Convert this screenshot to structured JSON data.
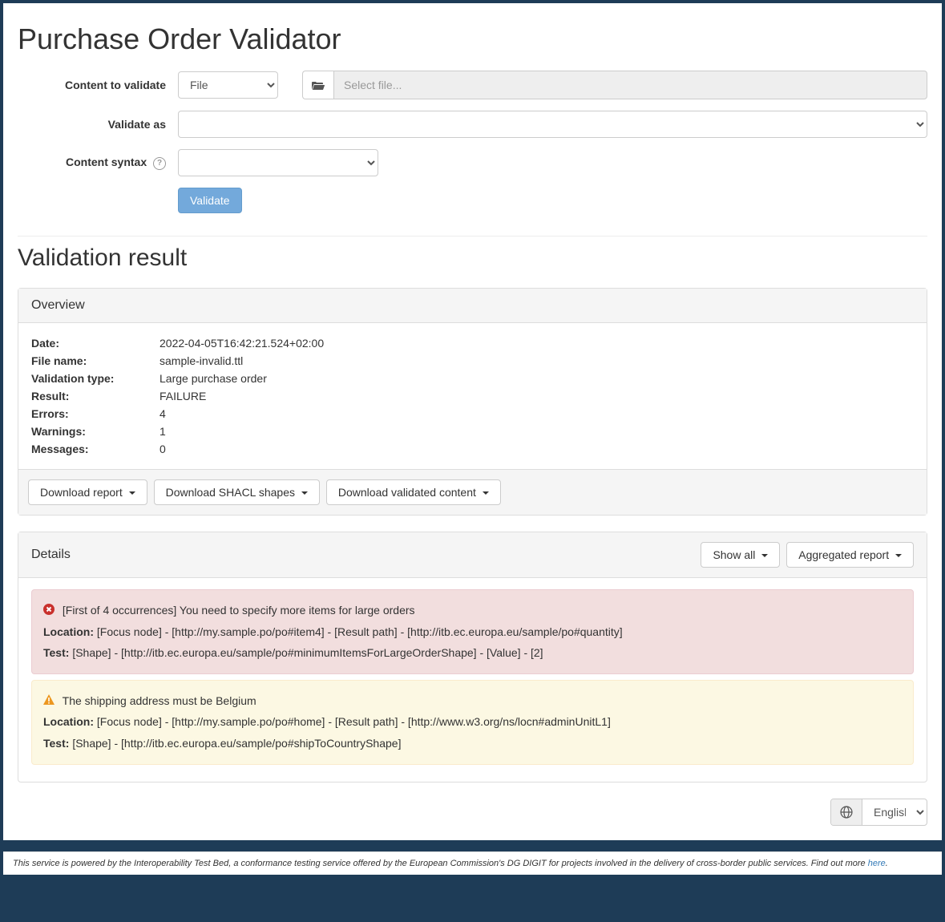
{
  "title": "Purchase Order Validator",
  "form": {
    "content_label": "Content to validate",
    "content_mode": "File",
    "file_placeholder": "Select file...",
    "validate_as_label": "Validate as",
    "validate_as_value": "",
    "syntax_label": "Content syntax",
    "syntax_value": "",
    "validate_button": "Validate"
  },
  "result_title": "Validation result",
  "overview": {
    "heading": "Overview",
    "date_label": "Date:",
    "date_value": "2022-04-05T16:42:21.524+02:00",
    "file_label": "File name:",
    "file_value": "sample-invalid.ttl",
    "type_label": "Validation type:",
    "type_value": "Large purchase order",
    "result_label": "Result:",
    "result_value": "FAILURE",
    "errors_label": "Errors:",
    "errors_value": "4",
    "warnings_label": "Warnings:",
    "warnings_value": "1",
    "messages_label": "Messages:",
    "messages_value": "0",
    "dl_report": "Download report",
    "dl_shapes": "Download SHACL shapes",
    "dl_content": "Download validated content"
  },
  "details": {
    "heading": "Details",
    "show_all": "Show all",
    "aggregated": "Aggregated report",
    "items": [
      {
        "severity": "error",
        "msg": "[First of 4 occurrences] You need to specify more items for large orders",
        "loc_label": "Location:",
        "loc_value": "[Focus node] - [http://my.sample.po/po#item4] - [Result path] - [http://itb.ec.europa.eu/sample/po#quantity]",
        "test_label": "Test:",
        "test_value": "[Shape] - [http://itb.ec.europa.eu/sample/po#minimumItemsForLargeOrderShape] - [Value] - [2]"
      },
      {
        "severity": "warn",
        "msg": "The shipping address must be Belgium",
        "loc_label": "Location:",
        "loc_value": "[Focus node] - [http://my.sample.po/po#home] - [Result path] - [http://www.w3.org/ns/locn#adminUnitL1]",
        "test_label": "Test:",
        "test_value": "[Shape] - [http://itb.ec.europa.eu/sample/po#shipToCountryShape]"
      }
    ]
  },
  "language": "English",
  "footer": {
    "text": "This service is powered by the Interoperability Test Bed, a conformance testing service offered by the European Commission's DG DIGIT for projects involved in the delivery of cross-border public services. Find out more ",
    "link": "here"
  }
}
